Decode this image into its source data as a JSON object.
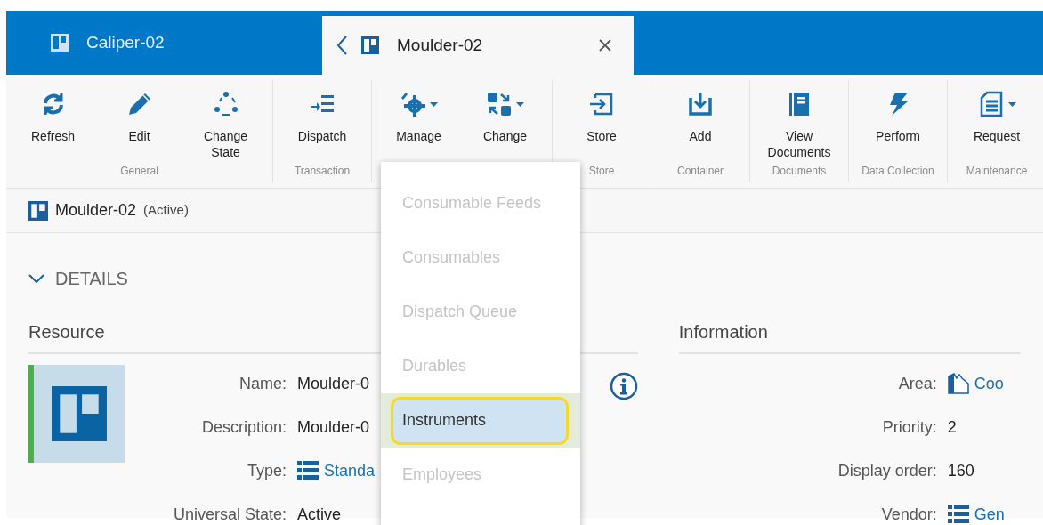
{
  "tabs": [
    {
      "label": "Caliper-02",
      "selected": false
    },
    {
      "label": "Moulder-02",
      "selected": true
    }
  ],
  "toolbar": {
    "groups": [
      {
        "label": "General",
        "items": [
          {
            "label": "Refresh",
            "dropdown": false
          },
          {
            "label": "Edit",
            "dropdown": false
          },
          {
            "label": "Change State",
            "dropdown": false
          }
        ]
      },
      {
        "label": "Transaction",
        "items": [
          {
            "label": "Dispatch",
            "dropdown": false
          }
        ]
      },
      {
        "items": [
          {
            "label": "Manage",
            "dropdown": true
          },
          {
            "label": "Change",
            "dropdown": true
          }
        ]
      },
      {
        "label": "Store",
        "items": [
          {
            "label": "Store",
            "dropdown": false
          }
        ]
      },
      {
        "label": "Container",
        "items": [
          {
            "label": "Add",
            "dropdown": false
          }
        ]
      },
      {
        "label": "Documents",
        "items": [
          {
            "label": "View Documents",
            "dropdown": false
          }
        ]
      },
      {
        "label": "Data Collection",
        "items": [
          {
            "label": "Perform",
            "dropdown": false
          }
        ]
      },
      {
        "label": "Maintenance",
        "items": [
          {
            "label": "Request",
            "dropdown": true
          }
        ]
      }
    ]
  },
  "header": {
    "name": "Moulder-02",
    "state": "(Active)"
  },
  "details": {
    "title": "DETAILS",
    "expanded": true,
    "resource": {
      "title": "Resource",
      "fields": [
        {
          "label": "Name:",
          "value": "Moulder-0",
          "kind": "text"
        },
        {
          "label": "Description:",
          "value": "Moulder-0",
          "kind": "text"
        },
        {
          "label": "Type:",
          "value": "Standa",
          "kind": "list_link"
        },
        {
          "label": "Universal State:",
          "value": "Active",
          "kind": "text"
        }
      ]
    },
    "information": {
      "title": "Information",
      "fields": [
        {
          "label": "Area:",
          "value": "Coo",
          "kind": "area_link"
        },
        {
          "label": "Priority:",
          "value": "2",
          "kind": "text"
        },
        {
          "label": "Display order:",
          "value": "160",
          "kind": "text"
        },
        {
          "label": "Vendor:",
          "value": "Gen",
          "kind": "list_link"
        }
      ]
    }
  },
  "manage_menu": {
    "items": [
      {
        "label": "Consumable Feeds",
        "disabled": true,
        "selected": false
      },
      {
        "label": "Consumables",
        "disabled": true,
        "selected": false
      },
      {
        "label": "Dispatch Queue",
        "disabled": true,
        "selected": false
      },
      {
        "label": "Durables",
        "disabled": true,
        "selected": false
      },
      {
        "label": "Instruments",
        "disabled": false,
        "selected": true
      },
      {
        "label": "Employees",
        "disabled": true,
        "selected": false
      }
    ]
  }
}
